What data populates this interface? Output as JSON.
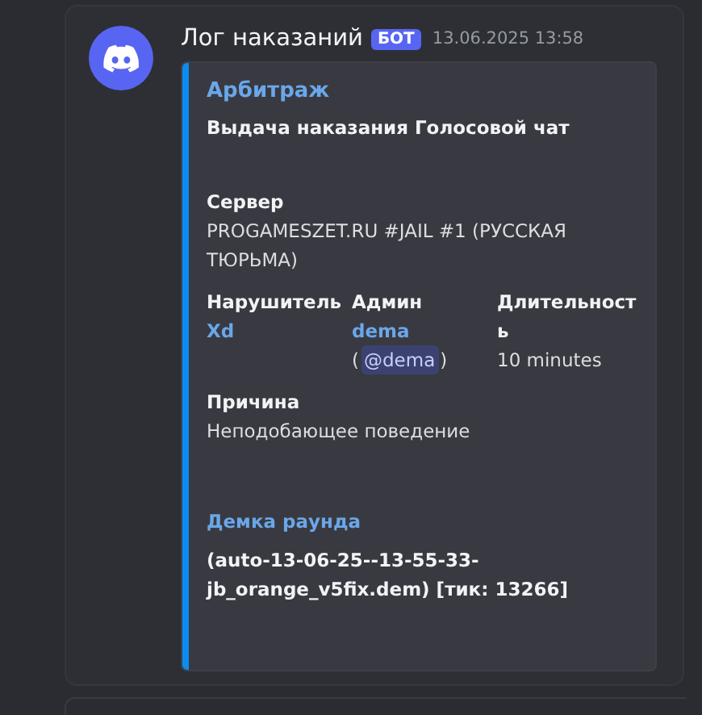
{
  "message": {
    "author": "Лог наказаний",
    "badge": "БОТ",
    "timestamp": "13.06.2025 13:58",
    "embed": {
      "title": "Арбитраж",
      "description": "Выдача наказания Голосовой чат",
      "fields": [
        {
          "name": "Сервер",
          "value": "PROGAMESZET.RU #JAIL #1 (РУССКАЯ ТЮРЬМА)",
          "inline": false,
          "kind": "text"
        },
        {
          "name": "Нарушитель",
          "value": "Xd",
          "inline": true,
          "kind": "link"
        },
        {
          "name": "Админ",
          "value": "dema",
          "mention_open": "(",
          "mention": "@dema",
          "mention_close": ")",
          "inline": true,
          "kind": "user"
        },
        {
          "name": "Длительность",
          "value": "10 minutes",
          "inline": true,
          "kind": "text"
        },
        {
          "name": "Причина",
          "value": "Неподобающее поведение",
          "inline": false,
          "kind": "text"
        }
      ],
      "footer_title": "Демка раунда",
      "footer_text": "(auto-13-06-25--13-55-33-jb_orange_v5fix.dem) [тик: 13266]"
    }
  }
}
